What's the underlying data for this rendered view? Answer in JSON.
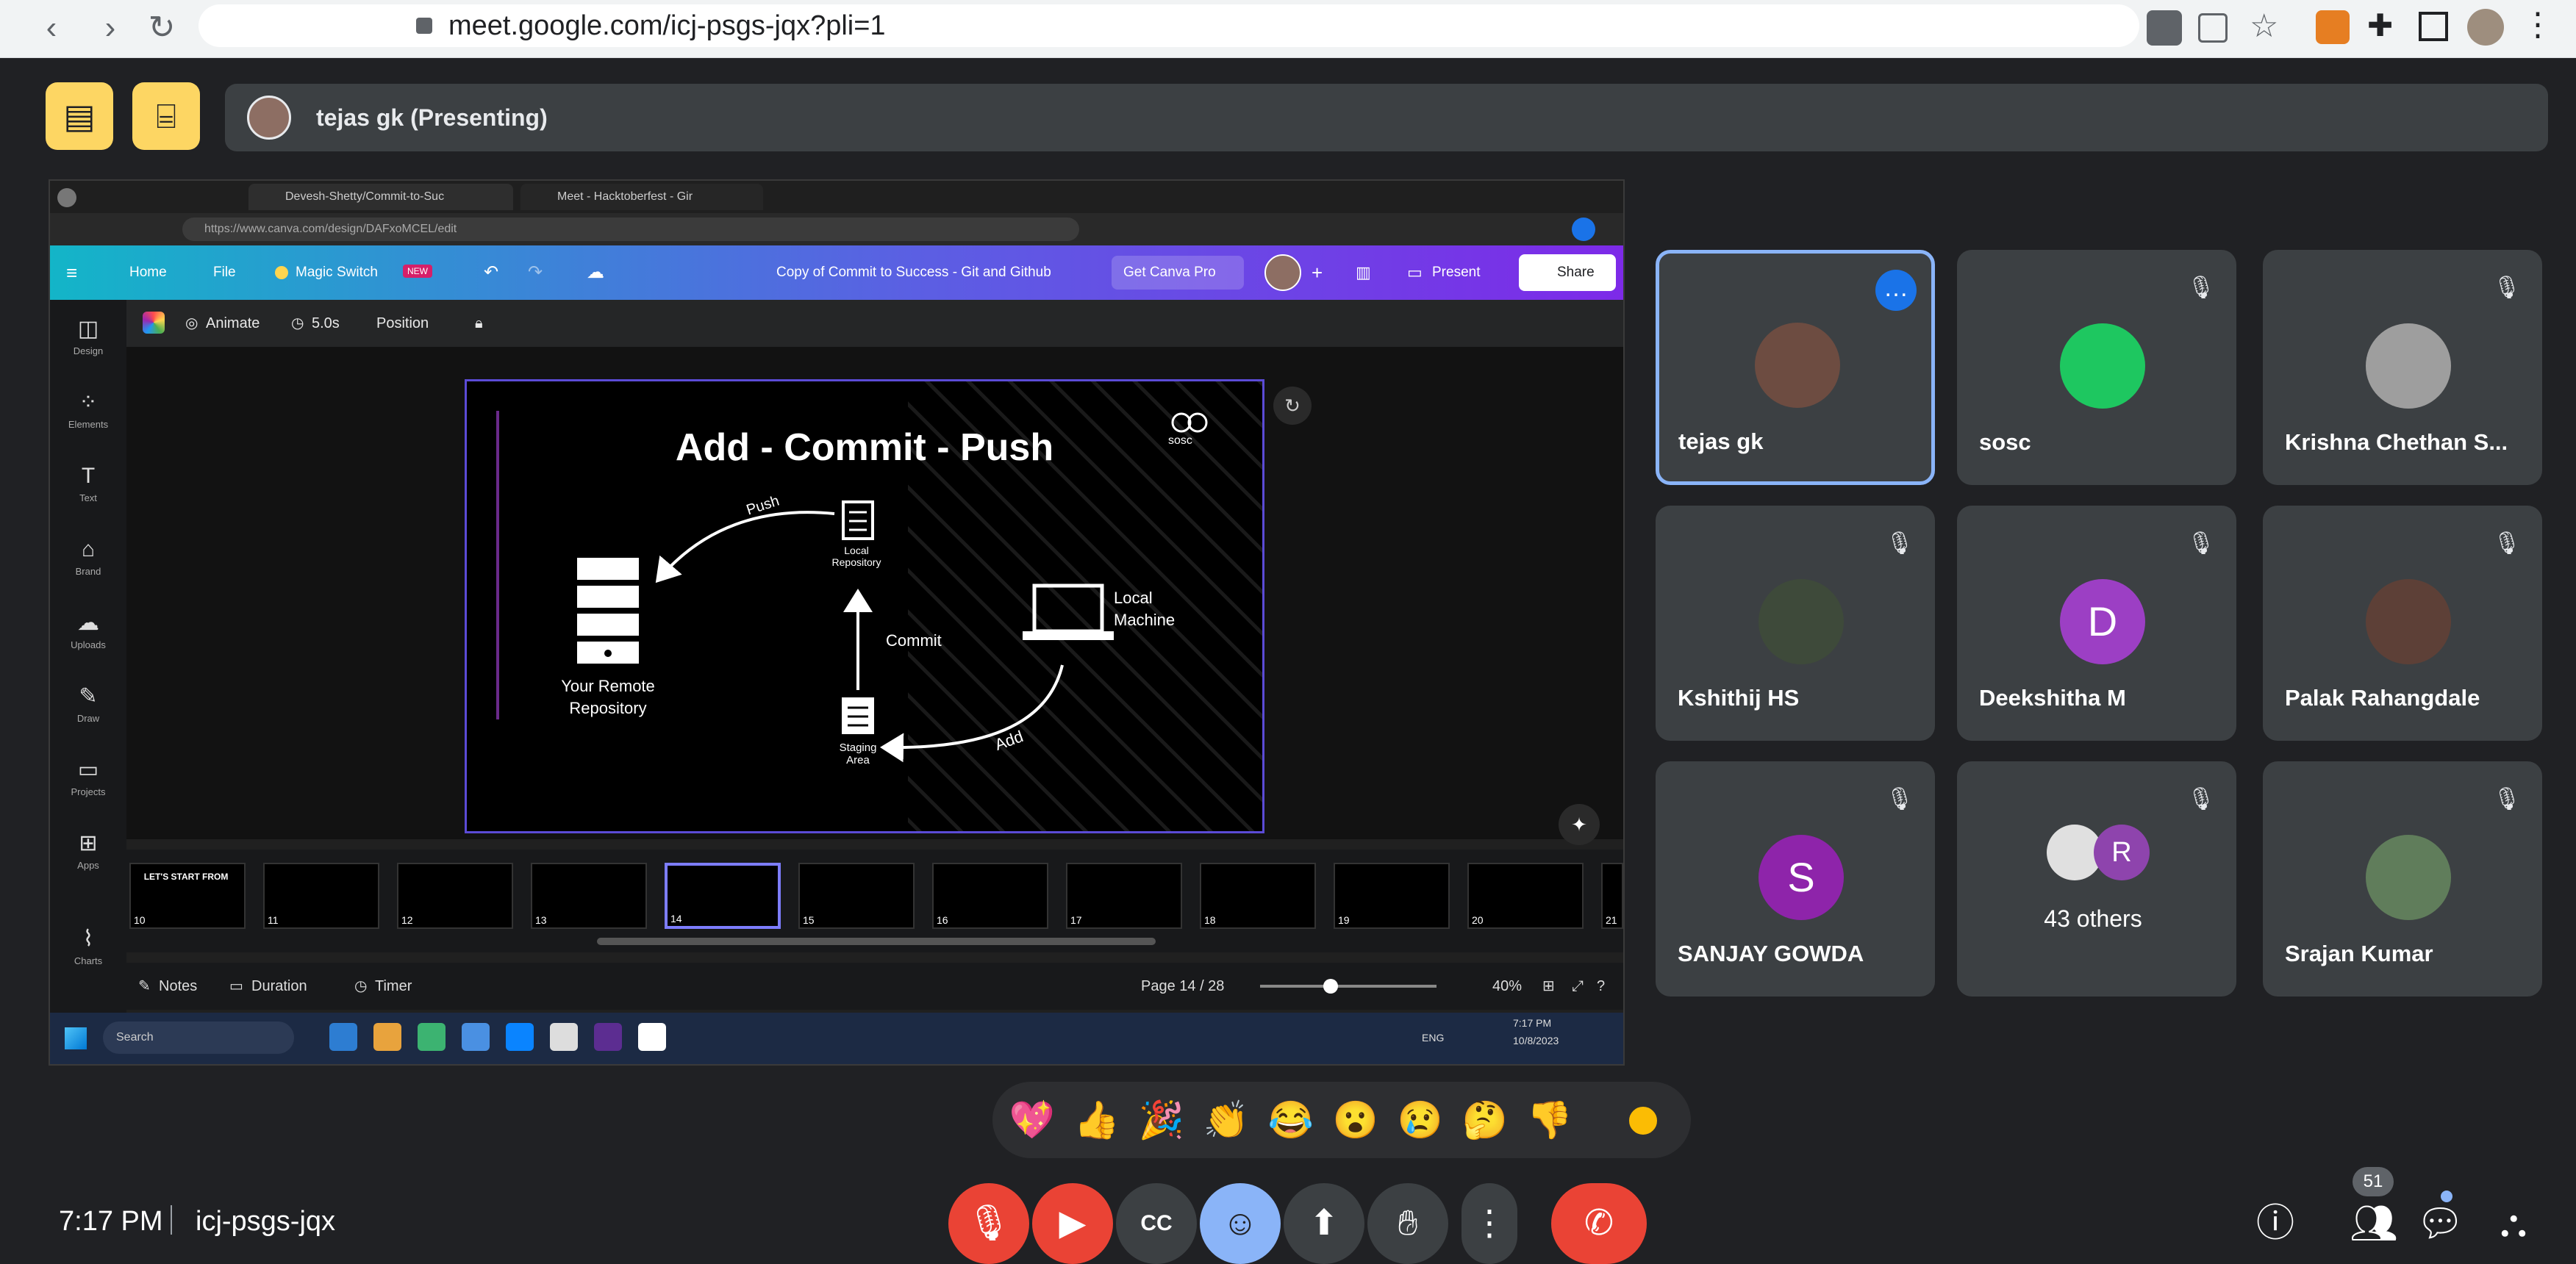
{
  "browser": {
    "url": "meet.google.com/icj-psgs-jqx?pli=1"
  },
  "topbar": {
    "presenter_label": "tejas gk (Presenting)"
  },
  "shared_screen": {
    "tabs": [
      "Devesh-Shetty/Commit-to-Suc",
      "Meet - Hacktoberfest - Gir"
    ],
    "url": "https://www.canva.com/design/DAFxoMCEL/edit",
    "canva_menu": {
      "home": "Home",
      "file": "File",
      "magic_switch": "Magic Switch",
      "new_badge": "NEW",
      "doc_title": "Copy of Commit to Success - Git and Github",
      "get_pro": "Get Canva Pro",
      "present": "Present",
      "share": "Share"
    },
    "side_items": [
      "Design",
      "Elements",
      "Text",
      "Brand",
      "Uploads",
      "Draw",
      "Projects",
      "Apps",
      "Charts"
    ],
    "toolbar": {
      "animate": "Animate",
      "duration": "5.0s",
      "position": "Position"
    },
    "slide": {
      "title": "Add - Commit - Push",
      "logo": "sosc",
      "local_repo": "Local Repository",
      "remote_repo": "Your Remote Repository",
      "local_machine": "Local Machine",
      "staging": "Staging Area",
      "push": "Push",
      "commit": "Commit",
      "add": "Add"
    },
    "thumbnails": [
      "10",
      "11",
      "12",
      "13",
      "14",
      "15",
      "16",
      "17",
      "18",
      "19",
      "20",
      "21"
    ],
    "thumb10_text": "LET'S START FROM",
    "footer": {
      "notes": "Notes",
      "duration": "Duration",
      "timer": "Timer",
      "page": "Page 14 / 28",
      "zoom": "40%"
    },
    "taskbar": {
      "search": "Search",
      "lang": "ENG",
      "clock": "7:17 PM",
      "date": "10/8/2023"
    }
  },
  "participants": [
    {
      "name": "tejas gk",
      "avatar_color": "#6d4c41",
      "initial": "",
      "muted": false
    },
    {
      "name": "sosc",
      "avatar_color": "#1ec760",
      "initial": "",
      "muted": true
    },
    {
      "name": "Krishna Chethan S...",
      "avatar_color": "#9e9e9e",
      "initial": "",
      "muted": true
    },
    {
      "name": "Kshithij HS",
      "avatar_color": "#3e4a3a",
      "initial": "",
      "muted": true
    },
    {
      "name": "Deekshitha M",
      "avatar_color": "#9c3fc4",
      "initial": "D",
      "muted": true
    },
    {
      "name": "Palak Rahangdale",
      "avatar_color": "#5d4037",
      "initial": "",
      "muted": true
    },
    {
      "name": "SANJAY GOWDA",
      "avatar_color": "#8e24aa",
      "initial": "S",
      "muted": true
    },
    {
      "name": "43 others",
      "avatar_color": "#8e44ad",
      "initial": "R",
      "muted": true
    },
    {
      "name": "Srajan Kumar",
      "avatar_color": "#607d5b",
      "initial": "",
      "muted": true
    }
  ],
  "reactions": [
    "💖",
    "👍",
    "🎉",
    "👏",
    "😂",
    "😮",
    "😢",
    "🤔",
    "👎"
  ],
  "bottom": {
    "time": "7:17 PM",
    "meeting_code": "icj-psgs-jqx",
    "people_count": "51"
  }
}
